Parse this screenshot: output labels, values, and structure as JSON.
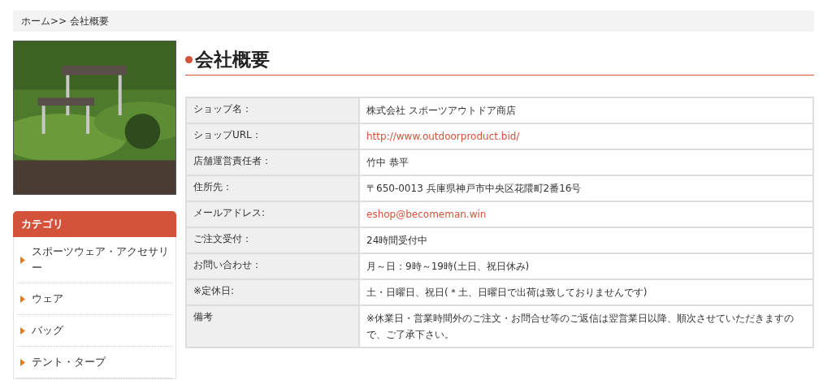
{
  "breadcrumb": "ホーム>> 会社概要",
  "sidebar": {
    "title": "カテゴリ",
    "items": [
      {
        "label": "スポーツウェア・アクセサリー"
      },
      {
        "label": "ウェア"
      },
      {
        "label": "バッグ"
      },
      {
        "label": "テント・タープ"
      }
    ]
  },
  "heading": "会社概要",
  "table": {
    "rows": [
      {
        "label": "ショップ名：",
        "value": "株式会社 スポーツアウトドア商店",
        "kind": "text"
      },
      {
        "label": "ショップURL：",
        "value": "http://www.outdoorproduct.bid/",
        "kind": "link"
      },
      {
        "label": "店舗運営責任者：",
        "value": "竹中 恭平",
        "kind": "text"
      },
      {
        "label": "住所先：",
        "value": "〒650-0013 兵庫県神戸市中央区花隈町2番16号",
        "kind": "text"
      },
      {
        "label": "メールアドレス:",
        "value": "eshop@becomeman.win",
        "kind": "link"
      },
      {
        "label": "ご注文受付：",
        "value": "24時間受付中",
        "kind": "text"
      },
      {
        "label": "お問い合わせ：",
        "value": "月～日：9時～19時(土日、祝日休み)",
        "kind": "text"
      },
      {
        "label": "※定休日:",
        "value": "土・日曜日、祝日(＊土、日曜日で出荷は致しておりませんです)",
        "kind": "text"
      },
      {
        "label": "備考",
        "value": "※休業日・営業時間外のご注文・お問合せ等のご返信は翌営業日以降、順次させていただきますので、ご了承下さい。",
        "kind": "text"
      }
    ]
  }
}
